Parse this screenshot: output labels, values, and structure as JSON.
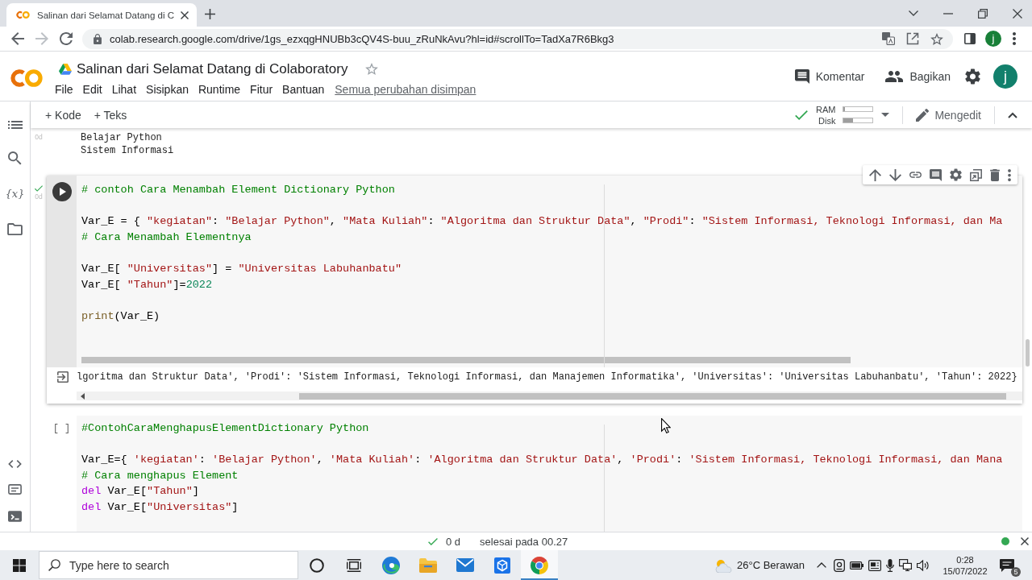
{
  "browser": {
    "tab_title": "Salinan dari Selamat Datang di C",
    "nav": [
      {
        "kind": "back",
        "disabled": false
      },
      {
        "kind": "forward",
        "disabled": true
      },
      {
        "kind": "reload",
        "disabled": false
      }
    ],
    "url": "colab.research.google.com/drive/1gs_ezxqgHNUBb3cQV4S-buu_zRuNkAvu?hl=id#scrollTo=TadXa7R6Bkg3",
    "profile_initial": "j"
  },
  "header": {
    "title": "Salinan dari Selamat Datang di Colaboratory",
    "menu": [
      "File",
      "Edit",
      "Lihat",
      "Sisipkan",
      "Runtime",
      "Fitur",
      "Bantuan"
    ],
    "save_status": "Semua perubahan disimpan",
    "actions": [
      {
        "kind": "comment",
        "label": "Komentar"
      },
      {
        "kind": "share",
        "label": "Bagikan"
      }
    ],
    "avatar_initial": "j"
  },
  "toolbar": {
    "add": [
      {
        "label": "+ Kode"
      },
      {
        "label": "+ Teks"
      }
    ],
    "connected": true,
    "meters": [
      {
        "label": "RAM",
        "level": 0.04
      },
      {
        "label": "Disk",
        "level": 0.32
      }
    ],
    "mode": "Mengedit"
  },
  "sidebar": {
    "top": [
      {
        "kind": "toc"
      },
      {
        "kind": "search"
      },
      {
        "kind": "glyph",
        "text": "{x}"
      },
      {
        "kind": "folder"
      }
    ],
    "bottom": [
      {
        "kind": "code"
      },
      {
        "kind": "snippets"
      },
      {
        "kind": "terminal"
      }
    ]
  },
  "cells": [
    {
      "kind": "output_tail",
      "exec_time": "0d",
      "output": [
        "Belajar Python",
        "Sistem Informasi"
      ]
    },
    {
      "kind": "code",
      "selected": true,
      "executed": true,
      "exec_time": "0d",
      "lines": [
        {
          "kind": "code",
          "tokens": [
            {
              "text": "# contoh Cara Menambah Element Dictionary Python",
              "kind": "comment"
            }
          ]
        },
        {
          "kind": "blank"
        },
        {
          "kind": "code",
          "tokens": [
            {
              "text": "Var_E = { ",
              "kind": "plain"
            },
            {
              "text": "\"kegiatan\"",
              "kind": "string"
            },
            {
              "text": ": ",
              "kind": "plain"
            },
            {
              "text": "\"Belajar Python\"",
              "kind": "string"
            },
            {
              "text": ", ",
              "kind": "plain"
            },
            {
              "text": "\"Mata Kuliah\"",
              "kind": "string"
            },
            {
              "text": ": ",
              "kind": "plain"
            },
            {
              "text": "\"Algoritma dan Struktur Data\"",
              "kind": "string"
            },
            {
              "text": ", ",
              "kind": "plain"
            },
            {
              "text": "\"Prodi\"",
              "kind": "string"
            },
            {
              "text": ": ",
              "kind": "plain"
            },
            {
              "text": "\"Sistem Informasi, Teknologi Informasi, dan Ma",
              "kind": "string"
            }
          ]
        },
        {
          "kind": "code",
          "tokens": [
            {
              "text": "# Cara Menambah Elementnya",
              "kind": "comment"
            }
          ]
        },
        {
          "kind": "blank"
        },
        {
          "kind": "code",
          "tokens": [
            {
              "text": "Var_E[ ",
              "kind": "plain"
            },
            {
              "text": "\"Universitas\"",
              "kind": "string"
            },
            {
              "text": "] = ",
              "kind": "plain"
            },
            {
              "text": "\"Universitas Labuhanbatu\"",
              "kind": "string"
            }
          ]
        },
        {
          "kind": "code",
          "tokens": [
            {
              "text": "Var_E[ ",
              "kind": "plain"
            },
            {
              "text": "\"Tahun\"",
              "kind": "string"
            },
            {
              "text": "]=",
              "kind": "plain"
            },
            {
              "text": "2022",
              "kind": "number"
            }
          ]
        },
        {
          "kind": "blank"
        },
        {
          "kind": "code",
          "tokens": [
            {
              "text": "print",
              "kind": "builtin"
            },
            {
              "text": "(Var_E)",
              "kind": "plain"
            }
          ]
        }
      ],
      "output": "lgoritma dan Struktur Data', 'Prodi': 'Sistem Informasi, Teknologi Informasi, dan Manajemen Informatika', 'Universitas': 'Universitas Labuhanbatu', 'Tahun': 2022}"
    },
    {
      "kind": "code",
      "selected": false,
      "executed": false,
      "prompt": "[ ]",
      "lines": [
        {
          "kind": "code",
          "tokens": [
            {
              "text": "#ContohCaraMenghapusElementDictionary Python",
              "kind": "comment"
            }
          ]
        },
        {
          "kind": "blank"
        },
        {
          "kind": "code",
          "tokens": [
            {
              "text": "Var_E={ ",
              "kind": "plain"
            },
            {
              "text": "'kegiatan'",
              "kind": "string"
            },
            {
              "text": ": ",
              "kind": "plain"
            },
            {
              "text": "'Belajar Python'",
              "kind": "string"
            },
            {
              "text": ", ",
              "kind": "plain"
            },
            {
              "text": "'Mata Kuliah'",
              "kind": "string"
            },
            {
              "text": ": ",
              "kind": "plain"
            },
            {
              "text": "'Algoritma dan Struktur Data'",
              "kind": "string"
            },
            {
              "text": ", ",
              "kind": "plain"
            },
            {
              "text": "'Prodi'",
              "kind": "string"
            },
            {
              "text": ": ",
              "kind": "plain"
            },
            {
              "text": "'Sistem Informasi, Teknologi Informasi, dan Mana",
              "kind": "string"
            }
          ]
        },
        {
          "kind": "code",
          "tokens": [
            {
              "text": "# Cara menghapus Element",
              "kind": "comment"
            }
          ]
        },
        {
          "kind": "code",
          "tokens": [
            {
              "text": "del",
              "kind": "keyword"
            },
            {
              "text": " Var_E[",
              "kind": "plain"
            },
            {
              "text": "\"Tahun\"",
              "kind": "string"
            },
            {
              "text": "]",
              "kind": "plain"
            }
          ]
        },
        {
          "kind": "code",
          "tokens": [
            {
              "text": "del",
              "kind": "keyword"
            },
            {
              "text": " Var_E[",
              "kind": "plain"
            },
            {
              "text": "\"Universitas\"",
              "kind": "string"
            },
            {
              "text": "]",
              "kind": "plain"
            }
          ]
        }
      ]
    }
  ],
  "status_bar": {
    "duration": "0 d",
    "message": "selesai pada 00.27"
  },
  "taskbar": {
    "search_placeholder": "Type here to search",
    "apps": [
      {
        "kind": "ring",
        "selected": false
      },
      {
        "kind": "task_view",
        "selected": false
      },
      {
        "kind": "swirl",
        "selected": false
      },
      {
        "kind": "folder",
        "selected": false
      },
      {
        "kind": "mail",
        "selected": false
      },
      {
        "kind": "cube",
        "selected": false
      },
      {
        "kind": "round_logo",
        "selected": true
      }
    ],
    "weather": "26°C Berawan",
    "time": "0:28",
    "date": "15/07/2022",
    "notifications": "5"
  }
}
